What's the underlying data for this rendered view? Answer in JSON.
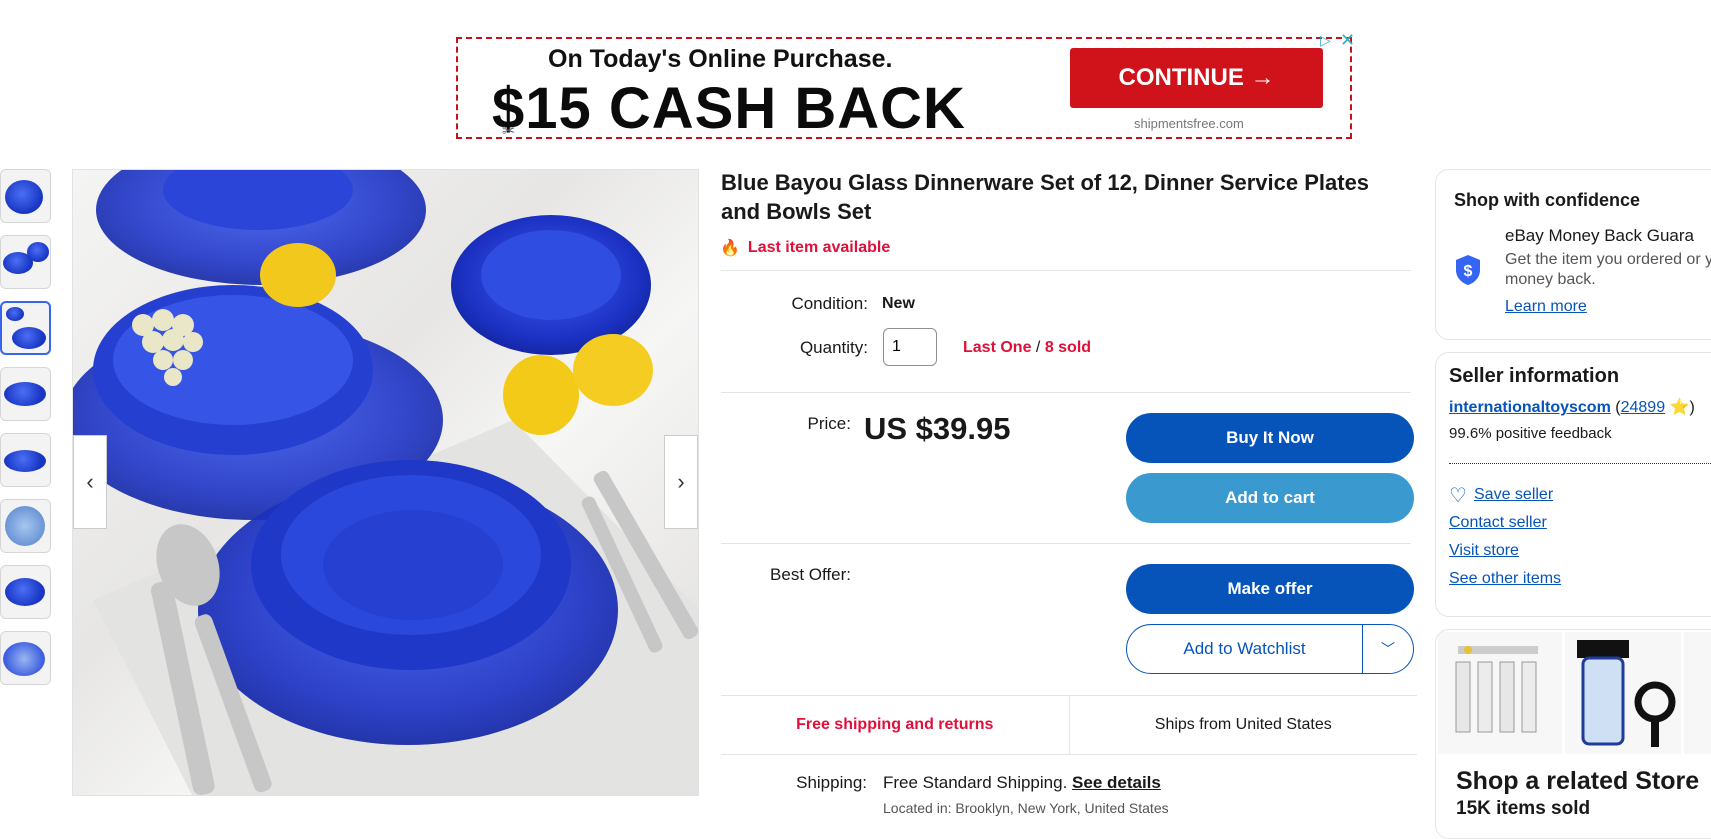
{
  "ad": {
    "line1": "On Today's Online Purchase.",
    "line2": "$15 CASH BACK",
    "cta": "CONTINUE →",
    "domain": "shipmentsfree.com",
    "choice_icon": "▷",
    "close_icon": "✕"
  },
  "gallery": {
    "prev_icon": "‹",
    "next_icon": "›",
    "thumbnail_count": 8,
    "selected_thumbnail": 3
  },
  "item": {
    "title": "Blue Bayou Glass Dinnerware Set of 12, Dinner Service Plates and Bowls Set",
    "availability": "Last item available",
    "condition_label": "Condition:",
    "condition_value": "New",
    "quantity_label": "Quantity:",
    "quantity_value": "1",
    "stock_status": "Last One",
    "stock_separator": " / ",
    "sold_count": "8 sold",
    "price_label": "Price:",
    "price": "US $39.95",
    "best_offer_label": "Best Offer:"
  },
  "actions": {
    "buy_now": "Buy It Now",
    "add_to_cart": "Add to cart",
    "make_offer": "Make offer",
    "add_to_watchlist": "Add to Watchlist"
  },
  "shipping": {
    "free_shipping": "Free shipping and returns",
    "ships_from": "Ships from United States",
    "label": "Shipping:",
    "method": "Free Standard Shipping.",
    "details_link": "See details",
    "location": "Located in: Brooklyn, New York, United States"
  },
  "confidence": {
    "title": "Shop with confidence",
    "guarantee_title": "eBay Money Back Guara",
    "guarantee_desc": "Get the item you ordered or your money back.",
    "learn_more": "Learn more"
  },
  "seller": {
    "title": "Seller information",
    "name": "internationaltoyscom",
    "feedback_open": " (",
    "feedback_score": "24899",
    "feedback_star": " ⭐)",
    "positive_feedback": "99.6% positive feedback",
    "save_seller": "Save seller",
    "contact_seller": "Contact seller",
    "visit_store": "Visit store",
    "see_other_items": "See other items"
  },
  "related_store": {
    "title": "Shop a related Store",
    "items_sold": "15K items sold"
  },
  "colors": {
    "primary_blue": "#0654ba",
    "secondary_blue": "#3a9ad0",
    "alert_red": "#e0103a",
    "ad_red": "#d0121b"
  }
}
